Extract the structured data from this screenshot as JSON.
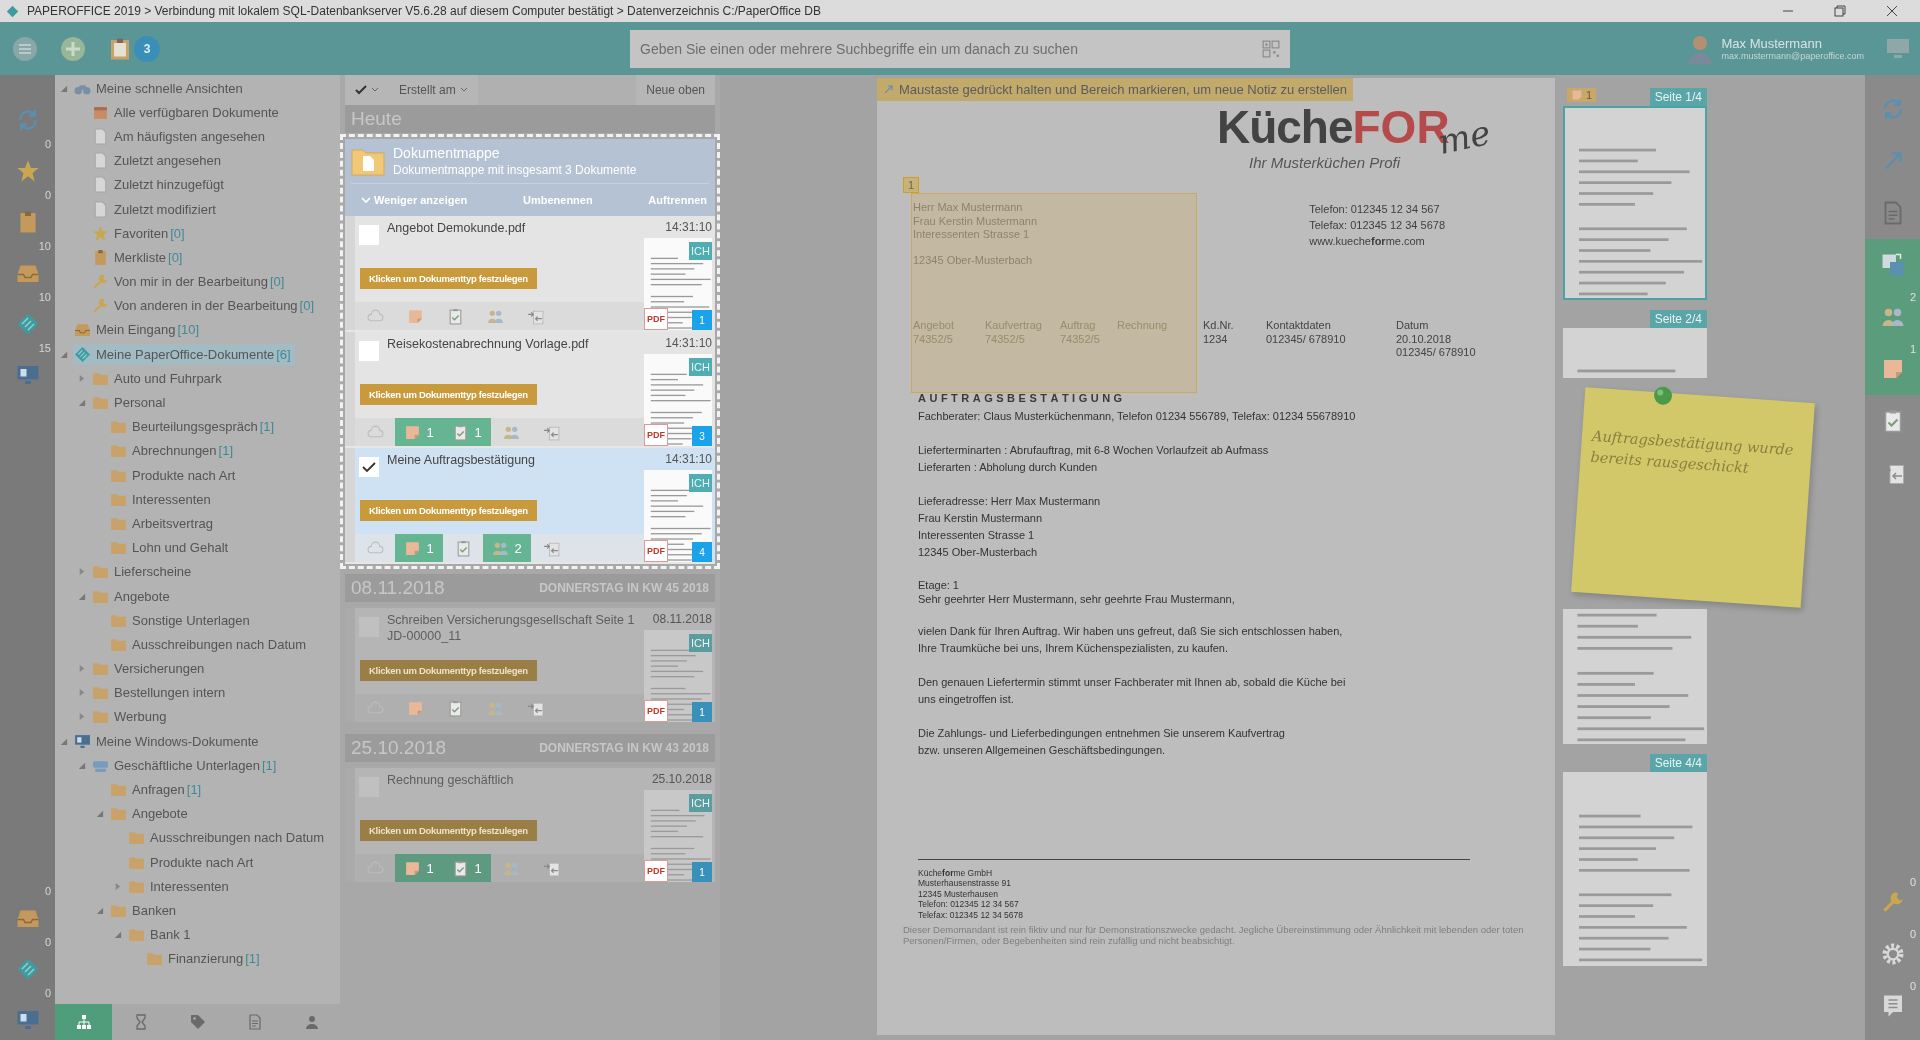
{
  "title_bar": {
    "title": "PAPEROFFICE 2019 > Verbindung mit lokalem SQL-Datenbankserver V5.6.28 auf diesem Computer bestätigt > Datenverzeichnis C:/PaperOffice DB"
  },
  "top_bar": {
    "task_badge": "3",
    "search": {
      "placeholder": "Geben Sie einen oder mehrere Suchbegriffe ein um danach zu suchen"
    },
    "user": {
      "name": "Max Mustermann",
      "email": "max.mustermann@paperoffice.com"
    }
  },
  "left_rail": {
    "top": [
      {
        "kind": "sync"
      },
      {
        "kind": "star",
        "count": "0"
      },
      {
        "kind": "clipboard",
        "count": "0"
      },
      {
        "kind": "inbox",
        "count": "10"
      },
      {
        "kind": "paperoffice",
        "count": "10"
      },
      {
        "kind": "windows",
        "count": "15"
      }
    ],
    "bottom": [
      {
        "kind": "inbox",
        "count": "0"
      },
      {
        "kind": "paperoffice",
        "count": "0"
      },
      {
        "kind": "windows",
        "count": "0"
      }
    ]
  },
  "tree": [
    {
      "label": "Meine schnelle Ansichten",
      "kind": "binoculars",
      "expanded": true,
      "selected": false,
      "children": [
        {
          "label": "Alle verfügbaren Dokumente",
          "kind": "box",
          "selected": false
        },
        {
          "label": "Am häufigsten angesehen",
          "kind": "doc",
          "selected": false
        },
        {
          "label": "Zuletzt angesehen",
          "kind": "doc",
          "selected": false
        },
        {
          "label": "Zuletzt hinzugefügt",
          "kind": "doc",
          "selected": false
        },
        {
          "label": "Zuletzt modifiziert",
          "kind": "doc",
          "selected": false
        },
        {
          "label": "Favoriten",
          "count": "[0]",
          "kind": "star",
          "selected": false
        },
        {
          "label": "Merkliste",
          "count": "[0]",
          "kind": "clipboard",
          "selected": false
        },
        {
          "label": "Von mir in der Bearbeitung",
          "count": "[0]",
          "kind": "wrench",
          "selected": false
        },
        {
          "label": "Von anderen in der Bearbeitung",
          "count": "[0]",
          "kind": "wrench",
          "selected": false
        }
      ]
    },
    {
      "label": "Mein Eingang",
      "count": "[10]",
      "kind": "inbox",
      "selected": false
    },
    {
      "label": "Meine PaperOffice-Dokumente",
      "count": "[6]",
      "kind": "paperoffice",
      "expanded": true,
      "selected": true,
      "children": [
        {
          "label": "Auto und Fuhrpark",
          "kind": "folder",
          "expanded": false,
          "selected": false
        },
        {
          "label": "Personal",
          "kind": "folder",
          "expanded": true,
          "selected": false,
          "children": [
            {
              "label": "Beurteilungsgespräch",
              "count": "[1]",
              "kind": "folder",
              "selected": false
            },
            {
              "label": "Abrechnungen",
              "count": "[1]",
              "kind": "folder",
              "selected": false
            },
            {
              "label": "Produkte nach Art",
              "kind": "folder",
              "selected": false
            },
            {
              "label": "Interessenten",
              "kind": "folder",
              "selected": false
            },
            {
              "label": "Arbeitsvertrag",
              "kind": "folder",
              "selected": false
            },
            {
              "label": "Lohn und Gehalt",
              "kind": "folder",
              "selected": false
            }
          ]
        },
        {
          "label": "Lieferscheine",
          "kind": "folder",
          "expanded": false,
          "selected": false
        },
        {
          "label": "Angebote",
          "kind": "folder",
          "expanded": true,
          "selected": false,
          "children": [
            {
              "label": "Sonstige Unterlagen",
              "kind": "folder",
              "selected": false
            },
            {
              "label": "Ausschreibungen nach Datum",
              "kind": "folder",
              "selected": false
            }
          ]
        },
        {
          "label": "Versicherungen",
          "kind": "folder",
          "expanded": false,
          "selected": false
        },
        {
          "label": "Bestellungen intern",
          "kind": "folder",
          "expanded": false,
          "selected": false
        },
        {
          "label": "Werbung",
          "kind": "folder",
          "expanded": false,
          "selected": false
        }
      ]
    },
    {
      "label": "Meine Windows-Dokumente",
      "kind": "windows",
      "expanded": true,
      "selected": false,
      "children": [
        {
          "label": "Geschäftliche Unterlagen",
          "count": "[1]",
          "kind": "drive",
          "expanded": true,
          "selected": false,
          "children": [
            {
              "label": "Anfragen",
              "count": "[1]",
              "kind": "folder",
              "selected": false
            },
            {
              "label": "Angebote",
              "kind": "folder",
              "expanded": true,
              "selected": false,
              "children": [
                {
                  "label": "Ausschreibungen nach Datum",
                  "kind": "folder",
                  "selected": false
                },
                {
                  "label": "Produkte nach Art",
                  "kind": "folder",
                  "selected": false
                },
                {
                  "label": "Interessenten",
                  "kind": "folder",
                  "expanded": false,
                  "selected": false
                }
              ]
            },
            {
              "label": "Banken",
              "kind": "folder",
              "expanded": true,
              "selected": false,
              "children": [
                {
                  "label": "Bank 1",
                  "kind": "folder",
                  "expanded": true,
                  "selected": false,
                  "children": [
                    {
                      "label": "Finanzierung",
                      "count": "[1]",
                      "kind": "folder",
                      "selected": false
                    }
                  ]
                }
              ]
            }
          ]
        }
      ]
    }
  ],
  "tree_tabs": [
    {
      "kind": "hierarchy",
      "selected": true
    },
    {
      "kind": "hourglass",
      "selected": false
    },
    {
      "kind": "tag",
      "selected": false
    },
    {
      "kind": "document",
      "selected": false
    },
    {
      "kind": "person",
      "selected": false
    }
  ],
  "list": {
    "toolbar": {
      "sort": "Erstellt am",
      "order": "Neue oben"
    },
    "groups": [
      {
        "date": "Heute",
        "items": [
          {
            "kind": "folder",
            "spotlight": true,
            "title": "Dokumentmappe",
            "subtitle": "Dokumentmappe mit insgesamt 3 Dokumente",
            "actions": [
              "Weniger anzeigen",
              "Umbenennen",
              "Auftrennen"
            ],
            "documents": [
              {
                "title": "Angebot Demokunde.pdf",
                "time": "14:31:10",
                "checked": false,
                "selected": false,
                "type_button": "Klicken um Dokumenttyp festzulegen",
                "owner": "ICH",
                "file_type": "PDF",
                "pages": "1",
                "tools": [
                  {
                    "kind": "cloud",
                    "active": false
                  },
                  {
                    "kind": "note",
                    "active": false
                  },
                  {
                    "kind": "task",
                    "active": false
                  },
                  {
                    "kind": "people",
                    "active": false
                  },
                  {
                    "kind": "merge",
                    "active": false
                  }
                ]
              },
              {
                "title": "Reisekostenabrechnung Vorlage.pdf",
                "time": "14:31:10",
                "checked": false,
                "selected": false,
                "type_button": "Klicken um Dokumenttyp festzulegen",
                "owner": "ICH",
                "file_type": "PDF",
                "pages": "3",
                "tools": [
                  {
                    "kind": "cloud",
                    "active": false
                  },
                  {
                    "kind": "note",
                    "active": true,
                    "count": "1"
                  },
                  {
                    "kind": "task",
                    "active": true,
                    "count": "1"
                  },
                  {
                    "kind": "people",
                    "active": false
                  },
                  {
                    "kind": "merge",
                    "active": false
                  }
                ]
              },
              {
                "title": "Meine Auftragsbestätigung",
                "time": "14:31:10",
                "checked": true,
                "selected": true,
                "type_button": "Klicken um Dokumenttyp festzulegen",
                "owner": "ICH",
                "file_type": "PDF",
                "pages": "4",
                "tools": [
                  {
                    "kind": "cloud",
                    "active": false
                  },
                  {
                    "kind": "note",
                    "active": true,
                    "count": "1"
                  },
                  {
                    "kind": "task",
                    "active": false
                  },
                  {
                    "kind": "people",
                    "active": true,
                    "count": "2"
                  },
                  {
                    "kind": "merge",
                    "active": false
                  }
                ]
              }
            ]
          }
        ]
      },
      {
        "date": "08.11.2018",
        "weekday": "DONNERSTAG IN KW 45 2018",
        "items": [
          {
            "kind": "document",
            "spotlight": false,
            "title": "Schreiben Versicherungsgesellschaft Seite 1 JD-00000_11",
            "time": "08.11.2018",
            "checked": false,
            "selected": false,
            "type_button": "Klicken um Dokumenttyp festzulegen",
            "owner": "ICH",
            "file_type": "PDF",
            "pages": "1",
            "tools": [
              {
                "kind": "cloud",
                "active": false
              },
              {
                "kind": "note",
                "active": false
              },
              {
                "kind": "task",
                "active": false
              },
              {
                "kind": "people",
                "active": false
              },
              {
                "kind": "merge",
                "active": false
              }
            ]
          }
        ]
      },
      {
        "date": "25.10.2018",
        "weekday": "DONNERSTAG IN KW 43 2018",
        "items": [
          {
            "kind": "document",
            "spotlight": false,
            "title": "Rechnung geschäftlich",
            "time": "25.10.2018",
            "checked": false,
            "selected": false,
            "type_button": "Klicken um Dokumenttyp festzulegen",
            "owner": "ICH",
            "file_type": "PDF",
            "pages": "1",
            "tools": [
              {
                "kind": "cloud",
                "active": false
              },
              {
                "kind": "note",
                "active": true,
                "count": "1"
              },
              {
                "kind": "task",
                "active": true,
                "count": "1"
              },
              {
                "kind": "people",
                "active": false
              },
              {
                "kind": "merge",
                "active": false
              }
            ]
          }
        ]
      }
    ]
  },
  "viewer": {
    "hint": "Maustaste gedrückt halten und Bereich markieren, um neue Notiz zu erstellen",
    "page": {
      "logo": {
        "part_1": "Küche",
        "part_2": "FOR",
        "part_3": "me"
      },
      "tagline": "Ihr Musterküchen Profi",
      "annotation": {
        "label": "1"
      },
      "recipient": [
        "Herr Max Mustermann",
        "Frau Kerstin Mustermann",
        "Interessenten Strasse 1",
        "12345 Ober-Musterbach"
      ],
      "contact": [
        "Telefon: 012345 12 34 567",
        "Telefax: 012345 12 34 5678",
        "www.kueche**for**me.com"
      ],
      "references": [
        {
          "label": "Angebot",
          "values": [
            "74352/5"
          ]
        },
        {
          "label": "Kaufvertrag",
          "values": [
            "74352/5"
          ]
        },
        {
          "label": "Auftrag",
          "values": [
            "74352/5"
          ]
        },
        {
          "label": "Rechnung"
        },
        {
          "label": "Kd.Nr.",
          "values": [
            "1234"
          ]
        },
        {
          "label": "Kontaktdaten",
          "values": [
            "012345/ 678910"
          ]
        },
        {
          "label": "Datum",
          "values": [
            "20.10.2018",
            "012345/ 678910"
          ]
        }
      ],
      "heading": "AUFTRAGSBESTÄTIGUNG",
      "paragraphs": [
        [
          "Fachberater: Claus Musterküchenmann, Telefon 01234 556789, Telefax: 01234 55678910"
        ],
        [
          "Lieferterminarten : Abrufauftrag, mit 6-8 Wochen Vorlaufzeit ab Aufmass",
          "Lieferarten : Abholung durch Kunden"
        ],
        [
          "Lieferadresse: Herr Max Mustermann",
          "Frau Kerstin Mustermann",
          "Interessenten Strasse 1",
          "12345 Ober-Musterbach"
        ],
        [
          "Etage: 1",
          "Sehr geehrter Herr Mustermann, sehr geehrte Frau Mustermann,"
        ],
        [
          "vielen Dank für Ihren Auftrag. Wir haben uns gefreut, daß Sie sich entschlossen haben,",
          "Ihre Traumküche bei uns, Ihrem Küchenspezialisten, zu kaufen."
        ],
        [
          "Den genauen Liefertermin stimmt unser Fachberater mit Ihnen ab, sobald die Küche bei",
          "uns eingetroffen ist."
        ],
        [
          "Die Zahlungs- und Lieferbedingungen entnehmen Sie unserem Kaufvertrag",
          "bzw. unseren Allgemeinen Geschäftsbedingungen."
        ]
      ],
      "footer": [
        "Küche**for**me GmbH",
        "Musterhausenstrasse 91",
        "12345 Musterhausen",
        "Telefon: 012345 12 34 567",
        "Telefax: 012345 12 34 5678"
      ],
      "disclaimer": "Dieser Demomandant ist rein fiktiv und nur für Demonstrationszwecke gedacht. Jegliche Übereinstimmung oder Ähnlichkeit mit lebenden oder toten Personen/Firmen, oder Begebenheiten sind rein zufällig und nicht beabsichtigt."
    }
  },
  "thumbnails": [
    {
      "label": "Seite 1/4",
      "selected": true,
      "notes": "1"
    },
    {
      "label": "Seite 2/4",
      "selected": false
    },
    {
      "selected": false
    },
    {
      "label": "Seite 4/4",
      "selected": false
    }
  ],
  "sticky_note": {
    "text": "Auftragsbestätigung wurde bereits rausgeschickt"
  },
  "right_rail": {
    "top": [
      {
        "kind": "sync",
        "active": false
      },
      {
        "kind": "expand",
        "active": false
      },
      {
        "kind": "document",
        "active": false
      },
      {
        "kind": "translate",
        "active": true
      },
      {
        "kind": "people",
        "active": true,
        "count": "2"
      },
      {
        "kind": "note",
        "active": true,
        "count": "1"
      },
      {
        "kind": "task",
        "active": false
      },
      {
        "kind": "merge",
        "active": false
      }
    ],
    "bottom": [
      {
        "kind": "wrench",
        "active": false,
        "count": "0"
      },
      {
        "kind": "gear",
        "active": false,
        "count": "0"
      },
      {
        "kind": "list",
        "active": false,
        "count": "0"
      }
    ]
  }
}
